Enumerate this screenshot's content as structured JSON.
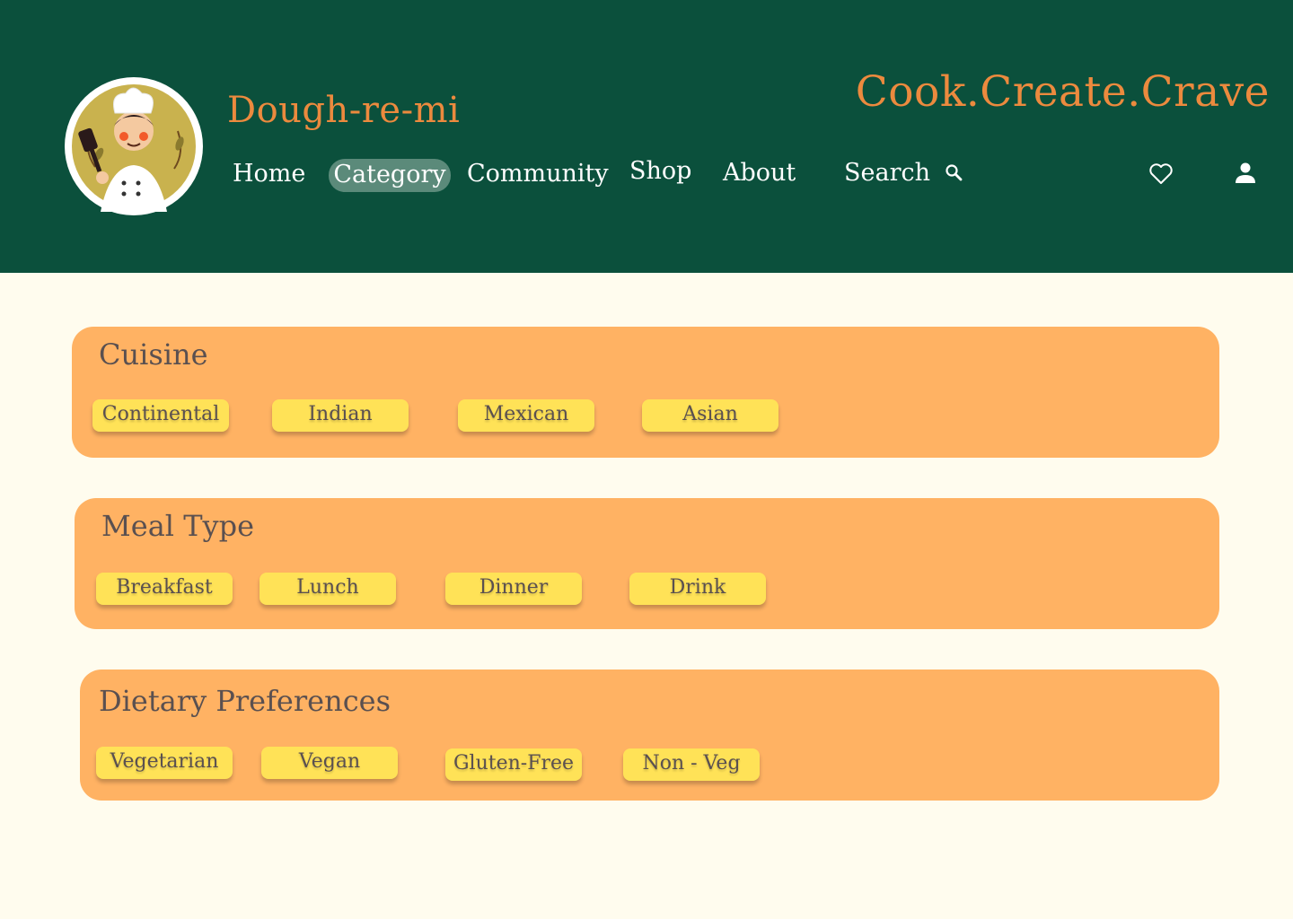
{
  "brand": {
    "name": "Dough-re-mi",
    "tagline": "Cook.Create.Crave",
    "logo_icon": "chef-logo-icon"
  },
  "nav": {
    "items": [
      "Home",
      "Category",
      "Community",
      "Shop",
      "About"
    ],
    "active": "Category",
    "search_label": "Search"
  },
  "icons": {
    "search": "search-icon",
    "favorites": "heart-icon",
    "account": "user-icon"
  },
  "categories": [
    {
      "title": "Cuisine",
      "options": [
        "Continental",
        "Indian",
        "Mexican",
        "Asian"
      ]
    },
    {
      "title": "Meal Type",
      "options": [
        "Breakfast",
        "Lunch",
        "Dinner",
        "Drink"
      ]
    },
    {
      "title": "Dietary Preferences",
      "options": [
        "Vegetarian",
        "Vegan",
        "Gluten-Free",
        "Non - Veg"
      ]
    }
  ],
  "colors": {
    "header": "#0B503C",
    "background": "#FFFCEE",
    "accent": "#EC8A3E",
    "panel": "#FFB263",
    "chip": "#FFE257",
    "active_nav": "#5B8A7A"
  }
}
